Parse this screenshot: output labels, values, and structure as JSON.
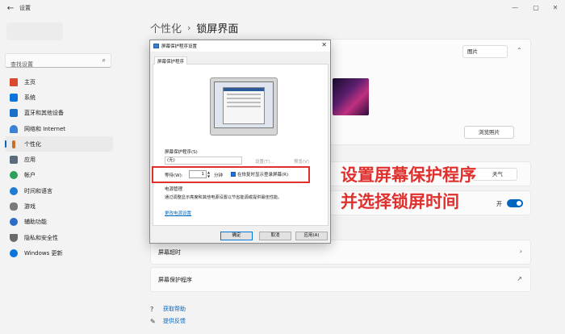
{
  "window": {
    "title": "设置",
    "back_icon": "back-arrow-icon",
    "controls": [
      "—",
      "▢",
      "✕"
    ]
  },
  "sidebar": {
    "search_placeholder": "查找设置",
    "items": [
      {
        "label": "主页",
        "icon": "home-icon",
        "color": "#d84a2b"
      },
      {
        "label": "系统",
        "icon": "monitor-icon",
        "color": "#0a74da"
      },
      {
        "label": "蓝牙和其他设备",
        "icon": "bluetooth-icon",
        "color": "#1a6fc9"
      },
      {
        "label": "网络和 Internet",
        "icon": "wifi-icon",
        "color": "#3a82d6"
      },
      {
        "label": "个性化",
        "icon": "brush-icon",
        "color": "#c96d2b"
      },
      {
        "label": "应用",
        "icon": "apps-icon",
        "color": "#5a6b7d"
      },
      {
        "label": "帐户",
        "icon": "account-icon",
        "color": "#2ca05a"
      },
      {
        "label": "时间和语言",
        "icon": "globe-icon",
        "color": "#1f7ad1"
      },
      {
        "label": "游戏",
        "icon": "gamepad-icon",
        "color": "#7a7a7a"
      },
      {
        "label": "辅助功能",
        "icon": "accessibility-icon",
        "color": "#2b6cc4"
      },
      {
        "label": "隐私和安全性",
        "icon": "shield-icon",
        "color": "#6b6b6b"
      },
      {
        "label": "Windows 更新",
        "icon": "update-icon",
        "color": "#0a74da"
      }
    ],
    "active_index": 4
  },
  "main": {
    "breadcrumb_parent": "个性化",
    "breadcrumb_sep": "›",
    "breadcrumb_current": "锁屏界面",
    "picture_select": "图片",
    "browse_button": "浏览照片",
    "status_select": "天气",
    "toggle_label": "开",
    "toggle_on": true,
    "rows": [
      {
        "label": "屏幕超时",
        "right": "›"
      },
      {
        "label": "屏幕保护程序",
        "right": "↗"
      }
    ],
    "help": [
      {
        "label": "获取帮助",
        "icon": "help-icon"
      },
      {
        "label": "提供反馈",
        "icon": "feedback-icon"
      }
    ]
  },
  "dialog": {
    "title": "屏幕保护程序设置",
    "tab": "屏幕保护程序",
    "screensaver_label": "屏幕保护程序(S)",
    "screensaver_value": "(无)",
    "settings_button": "设置(T)...",
    "preview_button": "预览(V)",
    "wait_label": "等待(W):",
    "wait_value": "1",
    "wait_unit": "分钟",
    "resume_checkbox": "在恢复时显示登录屏幕(R)",
    "resume_checked": true,
    "power_label": "电源管理",
    "power_desc": "通过调整显示亮度和其他电源设置以节省能源或提供最佳性能。",
    "power_link": "更改电源设置",
    "ok": "确定",
    "cancel": "取消",
    "apply": "应用(A)"
  },
  "annotation": {
    "line1": "设置屏幕保护程序",
    "line2": "并选择锁屏时间",
    "color": "#e0302d"
  }
}
